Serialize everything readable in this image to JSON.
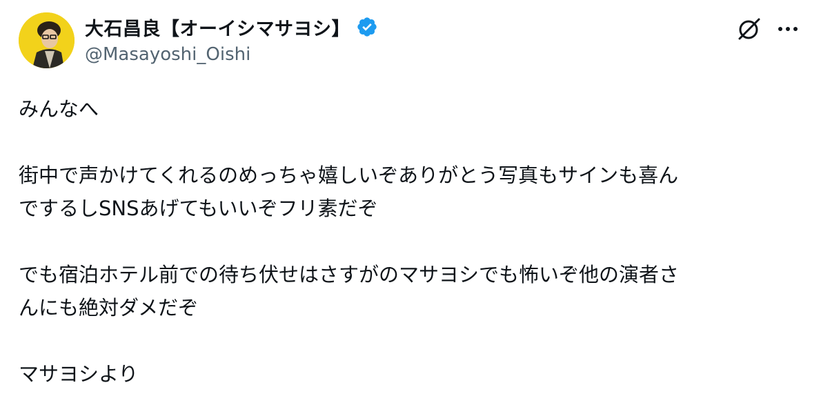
{
  "author": {
    "display_name": "大石昌良【オーイシマサヨシ】",
    "handle": "@Masayoshi_Oishi",
    "verified": true,
    "avatar_background": "#f2d21b"
  },
  "actions": {
    "grok_icon": "grok-icon",
    "more_icon": "more-icon"
  },
  "tweet": {
    "lines": [
      "みんなへ",
      "",
      "街中で声かけてくれるのめっちゃ嬉しいぞありがとう写真もサインも喜ん",
      "でするしSNSあげてもいいぞフリ素だぞ",
      "",
      "でも宿泊ホテル前での待ち伏せはさすがのマサヨシでも怖いぞ他の演者さ",
      "んにも絶対ダメだぞ",
      "",
      "マサヨシより"
    ]
  },
  "colors": {
    "text": "#0f1419",
    "secondary": "#536471",
    "verified": "#1d9bf0"
  }
}
